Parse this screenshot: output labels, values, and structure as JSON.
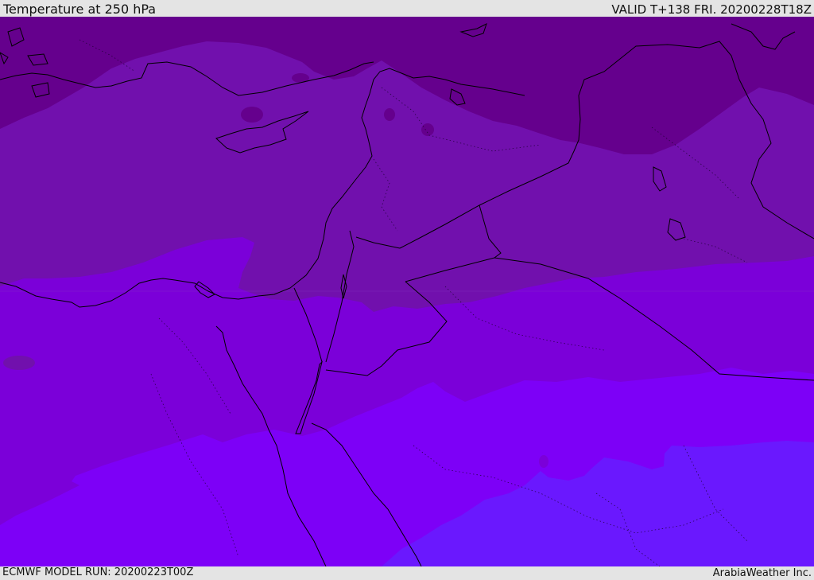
{
  "header": {
    "title": "Temperature at 250 hPa",
    "valid": "VALID T+138 FRI. 20200228T18Z"
  },
  "footer": {
    "model_run": "ECMWF MODEL RUN: 20200223T00Z",
    "credit": "ArabiaWeather Inc."
  },
  "map": {
    "bands": [
      {
        "name": "coldest",
        "color": "#65008d"
      },
      {
        "name": "cold",
        "color": "#7110ad"
      },
      {
        "name": "mid",
        "color": "#7b00d9"
      },
      {
        "name": "warm",
        "color": "#7d00f7"
      },
      {
        "name": "warmest",
        "color": "#6a18fe"
      }
    ],
    "border_color": "#000000"
  }
}
